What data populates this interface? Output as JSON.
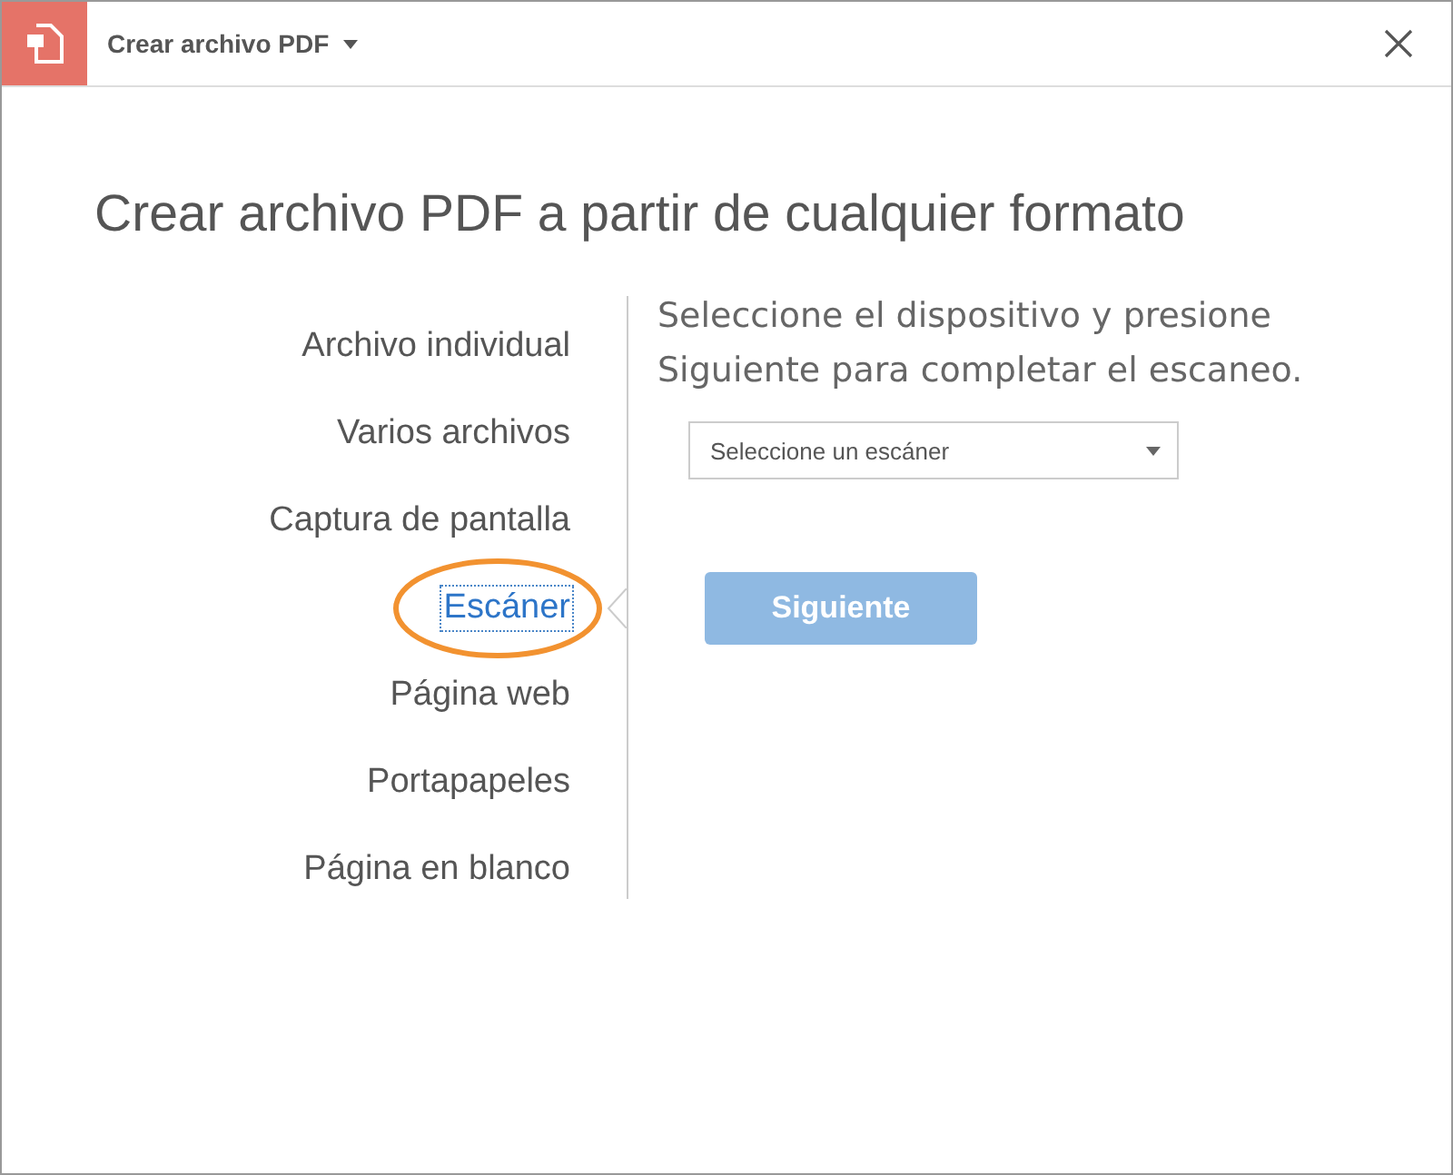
{
  "header": {
    "title": "Crear archivo PDF"
  },
  "heading": "Crear archivo PDF a partir de cualquier formato",
  "sources": [
    {
      "label": "Archivo individual",
      "selected": false
    },
    {
      "label": "Varios archivos",
      "selected": false
    },
    {
      "label": "Captura de pantalla",
      "selected": false
    },
    {
      "label": "Escáner",
      "selected": true
    },
    {
      "label": "Página web",
      "selected": false
    },
    {
      "label": "Portapapeles",
      "selected": false
    },
    {
      "label": "Página en blanco",
      "selected": false
    }
  ],
  "instructions": "Seleccione el dispositivo y presione Siguiente para completar el escaneo.",
  "scanner_select": {
    "placeholder": "Seleccione un escáner"
  },
  "next_button": {
    "label": "Siguiente",
    "disabled": true
  }
}
